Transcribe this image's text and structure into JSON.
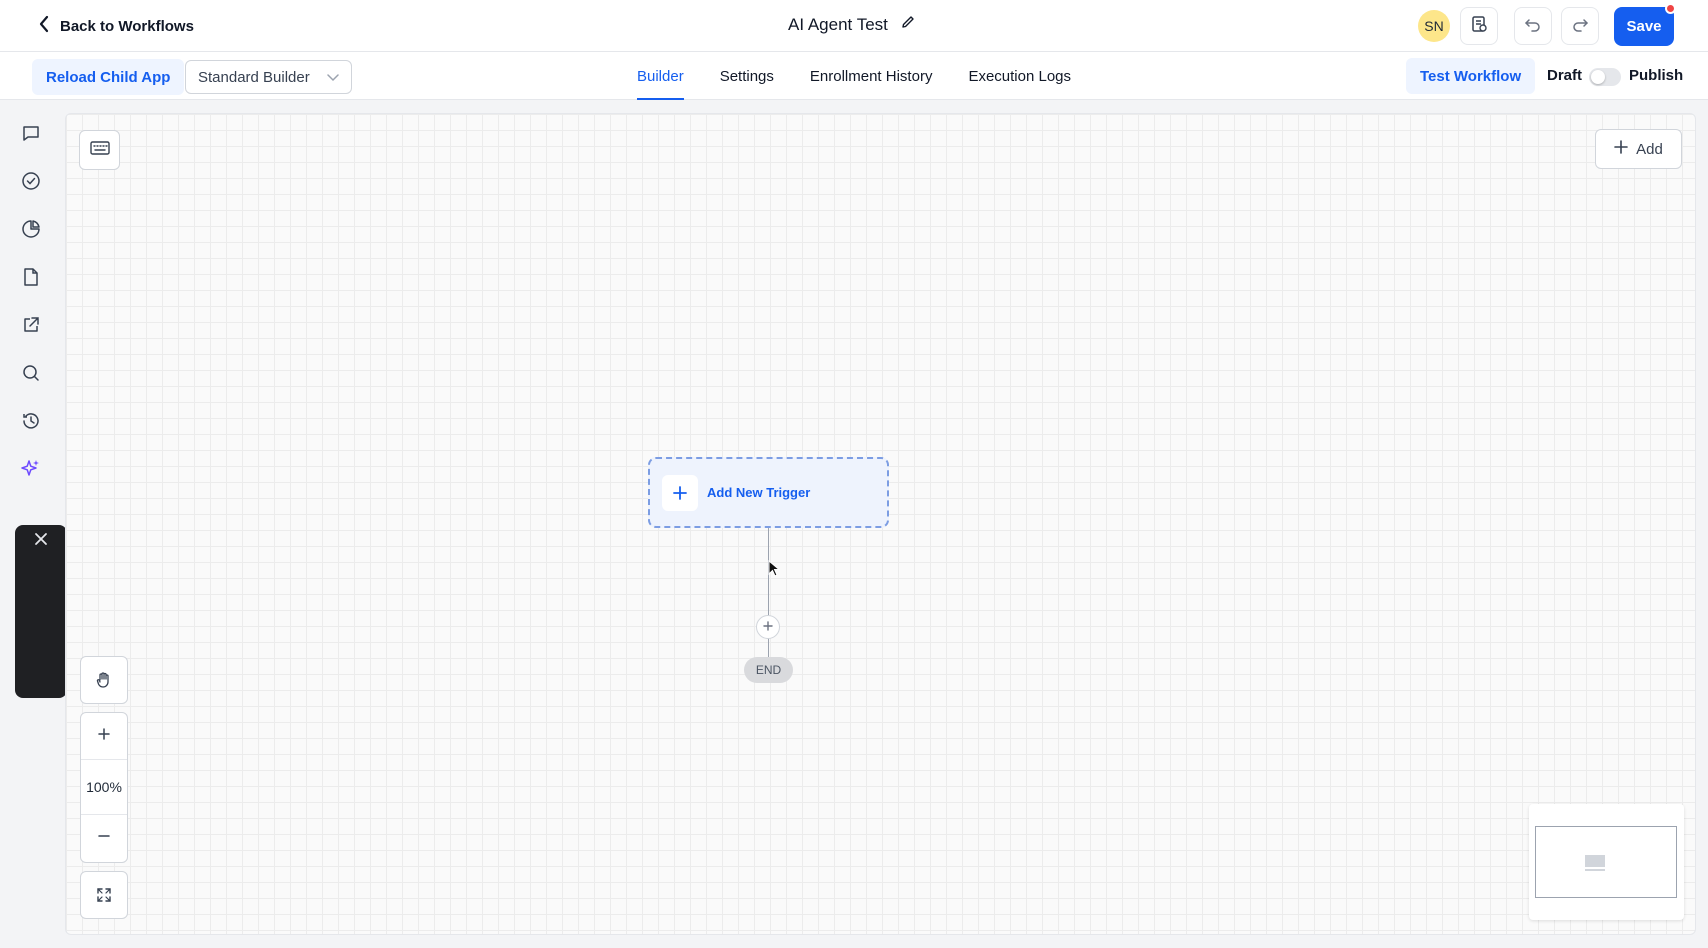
{
  "header": {
    "back_label": "Back to Workflows",
    "title": "AI Agent Test",
    "avatar_initials": "SN",
    "save_label": "Save",
    "accent_color": "#155eef"
  },
  "toolbar": {
    "reload_label": "Reload Child App",
    "builder_select_value": "Standard Builder",
    "tabs": [
      {
        "label": "Builder",
        "active": true
      },
      {
        "label": "Settings",
        "active": false
      },
      {
        "label": "Enrollment History",
        "active": false
      },
      {
        "label": "Execution Logs",
        "active": false
      }
    ],
    "test_label": "Test Workflow",
    "draft_label": "Draft",
    "publish_label": "Publish",
    "publish_toggle_on": false
  },
  "rail": {
    "icons": [
      "chat-icon",
      "check-circle-icon",
      "pie-chart-icon",
      "file-icon",
      "external-link-icon",
      "search-icon",
      "history-icon",
      "sparkles-icon"
    ]
  },
  "canvas": {
    "add_label": "Add",
    "trigger_label": "Add New Trigger",
    "end_label": "END",
    "zoom_level": "100%"
  }
}
